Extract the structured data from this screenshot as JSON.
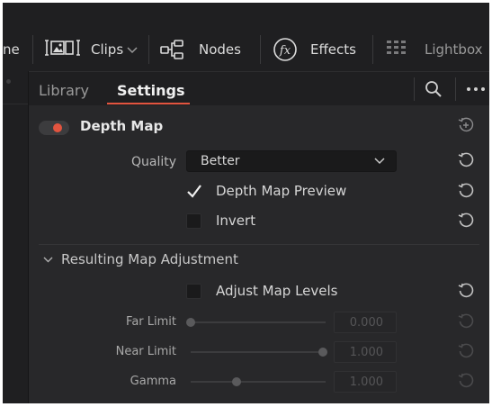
{
  "toolbar": {
    "partial_label": "ne",
    "clips_label": "Clips",
    "nodes_label": "Nodes",
    "effects_label": "Effects",
    "lightbox_label": "Lightbox"
  },
  "tabs": {
    "library_label": "Library",
    "settings_label": "Settings"
  },
  "effect": {
    "title": "Depth Map",
    "enabled": true,
    "quality_label": "Quality",
    "quality_value": "Better",
    "depth_map_preview_label": "Depth Map Preview",
    "depth_map_preview_checked": true,
    "invert_label": "Invert",
    "invert_checked": false
  },
  "adjustment": {
    "group_title": "Resulting Map Adjustment",
    "adjust_levels_label": "Adjust Map Levels",
    "adjust_levels_checked": false,
    "far_limit_label": "Far Limit",
    "far_limit_value": "0.000",
    "near_limit_label": "Near Limit",
    "near_limit_value": "1.000",
    "gamma_label": "Gamma",
    "gamma_value": "1.000"
  },
  "colors": {
    "accent": "#e2543f",
    "background": "#28282a",
    "toolbar": "#1f1f21"
  },
  "icons": [
    "clips-icon",
    "chevron-down-icon",
    "nodes-icon",
    "effects-fx-icon",
    "lightbox-grid-icon",
    "search-icon",
    "more-icon",
    "reset-icon",
    "chevron-down-icon"
  ]
}
